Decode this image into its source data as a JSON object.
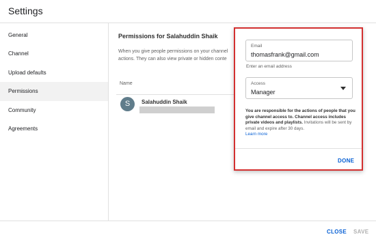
{
  "header": {
    "title": "Settings"
  },
  "sidebar": {
    "items": [
      {
        "label": "General"
      },
      {
        "label": "Channel"
      },
      {
        "label": "Upload defaults"
      },
      {
        "label": "Permissions"
      },
      {
        "label": "Community"
      },
      {
        "label": "Agreements"
      }
    ],
    "active": "Permissions"
  },
  "main": {
    "title": "Permissions for Salahuddin Shaik",
    "desc_line1": "When you give people permissions on your channel",
    "desc_line2": "actions. They can also view private or hidden conte",
    "name_header": "Name",
    "user": {
      "initial": "S",
      "name": "Salahuddin Shaik"
    }
  },
  "popup": {
    "email_label": "Email",
    "email_value": "thomasfrank@gmail.com",
    "email_helper": "Enter an email address",
    "access_label": "Access",
    "access_value": "Manager",
    "info_bold": "You are responsible for the actions of people that you give channel access to. Channel access includes private videos and playlists.",
    "info_rest": " Invitations will be sent by email and expire after 30 days.",
    "learn_more": "Learn more",
    "done_label": "DONE"
  },
  "footer": {
    "close_label": "CLOSE",
    "save_label": "SAVE"
  },
  "colors": {
    "accent": "#065fd4",
    "highlight_border": "#d32f2f",
    "avatar_bg": "#607d8b"
  }
}
